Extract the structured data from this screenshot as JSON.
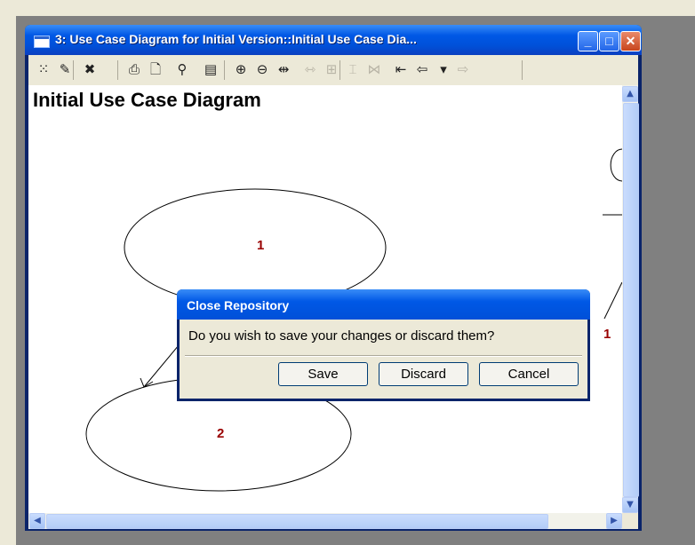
{
  "window": {
    "title": "3: Use Case Diagram for Initial Version::Initial Use Case Dia...",
    "minimize_glyph": "_",
    "maximize_glyph": "□",
    "close_glyph": "✕"
  },
  "toolbar": {
    "icons": [
      {
        "name": "grid-icon",
        "glyph": "⁙",
        "enabled": true
      },
      {
        "name": "pencil-icon",
        "glyph": "✎",
        "enabled": true
      },
      {
        "name": "delete-icon",
        "glyph": "✖",
        "enabled": true
      },
      {
        "name": "print-icon",
        "glyph": "⎙",
        "enabled": true
      },
      {
        "name": "print-preview-icon",
        "glyph": "🗋",
        "enabled": true
      },
      {
        "name": "find-icon",
        "glyph": "⚲",
        "enabled": true
      },
      {
        "name": "properties-icon",
        "glyph": "▤",
        "enabled": true
      },
      {
        "name": "zoom-in-icon",
        "glyph": "⊕",
        "enabled": true
      },
      {
        "name": "zoom-out-icon",
        "glyph": "⊖",
        "enabled": true
      },
      {
        "name": "fit-icon",
        "glyph": "⇹",
        "enabled": true
      },
      {
        "name": "align-horizontal-icon",
        "glyph": "⇿",
        "enabled": false
      },
      {
        "name": "align-grid-icon",
        "glyph": "⊞",
        "enabled": false
      },
      {
        "name": "align-center-icon",
        "glyph": "⌶",
        "enabled": false
      },
      {
        "name": "align-edges-icon",
        "glyph": "⋈",
        "enabled": false
      },
      {
        "name": "first-icon",
        "glyph": "⇤",
        "enabled": true
      },
      {
        "name": "back-icon",
        "glyph": "⇦",
        "enabled": true
      },
      {
        "name": "dropdown-arrow-icon",
        "glyph": "▾",
        "enabled": true
      },
      {
        "name": "forward-icon",
        "glyph": "⇨",
        "enabled": false
      }
    ]
  },
  "diagram": {
    "title": "Initial Use Case Diagram",
    "use_case_1_label": "1",
    "use_case_2_label": "2",
    "actor_multiplicity": "1"
  },
  "dialog": {
    "title": "Close Repository",
    "message": "Do you wish to save your changes or discard them?",
    "save_label": "Save",
    "discard_label": "Discard",
    "cancel_label": "Cancel"
  },
  "scrollbars": {
    "up_glyph": "▲",
    "down_glyph": "▼",
    "left_glyph": "◀",
    "right_glyph": "▶"
  }
}
